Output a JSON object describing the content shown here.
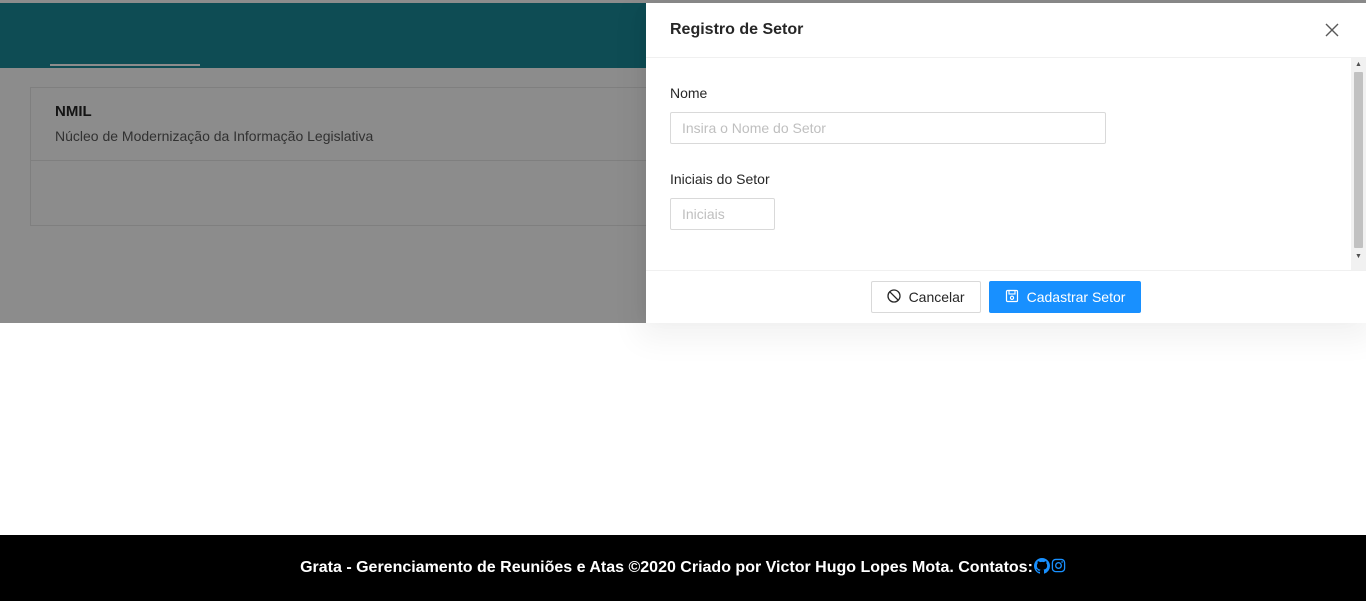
{
  "colors": {
    "header": "#1a8a9a",
    "primary": "#1890ff",
    "footer_bg": "#000000"
  },
  "card": {
    "title": "NMIL",
    "description": "Núcleo de Modernização da Informação Legislativa"
  },
  "drawer": {
    "title": "Registro de Setor",
    "close_icon": "close-icon",
    "fields": [
      {
        "label": "Nome",
        "placeholder": "Insira o Nome do Setor",
        "value": ""
      },
      {
        "label": "Iniciais do Setor",
        "placeholder": "Iniciais",
        "value": ""
      }
    ],
    "buttons": {
      "cancel": "Cancelar",
      "submit": "Cadastrar Setor"
    }
  },
  "footer": {
    "text": "Grata - Gerenciamento de Reuniões e Atas ©2020 Criado por Victor Hugo Lopes Mota. Contatos:",
    "icons": [
      "github-icon",
      "instagram-icon"
    ]
  }
}
